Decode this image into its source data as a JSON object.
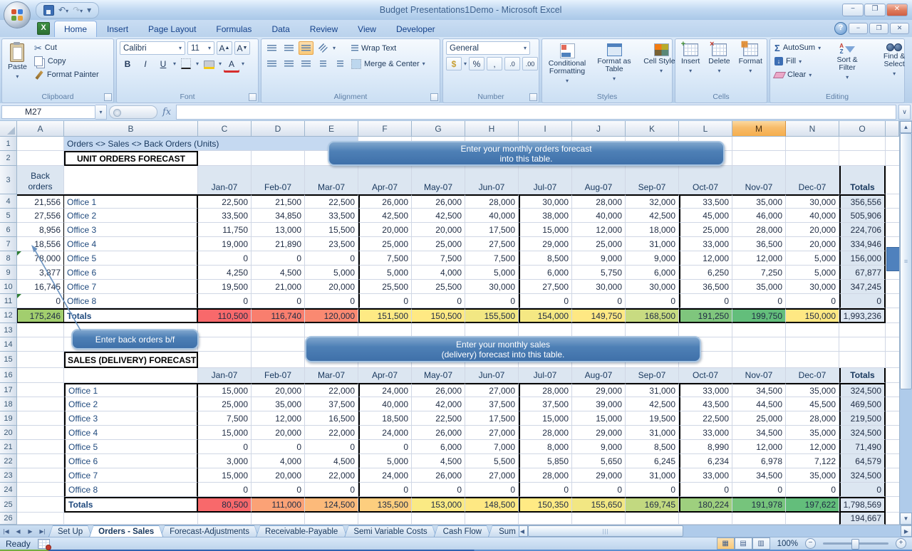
{
  "window": {
    "title": "Budget Presentations1Demo - Microsoft Excel"
  },
  "ribbon_tabs": [
    {
      "label": "Home",
      "active": true
    },
    {
      "label": "Insert"
    },
    {
      "label": "Page Layout"
    },
    {
      "label": "Formulas"
    },
    {
      "label": "Data"
    },
    {
      "label": "Review"
    },
    {
      "label": "View"
    },
    {
      "label": "Developer"
    }
  ],
  "ribbon": {
    "clipboard": {
      "label": "Clipboard",
      "paste": "Paste",
      "cut": "Cut",
      "copy": "Copy",
      "format_painter": "Format Painter"
    },
    "font": {
      "label": "Font",
      "family": "Calibri",
      "size": "11"
    },
    "alignment": {
      "label": "Alignment",
      "wrap": "Wrap Text",
      "merge": "Merge & Center"
    },
    "number": {
      "label": "Number",
      "format": "General"
    },
    "styles": {
      "label": "Styles",
      "conditional": "Conditional Formatting",
      "format_table": "Format as Table",
      "cell_styles": "Cell Styles"
    },
    "cells": {
      "label": "Cells",
      "insert": "Insert",
      "delete": "Delete",
      "format": "Format"
    },
    "editing": {
      "label": "Editing",
      "autosum": "AutoSum",
      "fill": "Fill",
      "clear": "Clear",
      "sort": "Sort & Filter",
      "find": "Find & Select"
    }
  },
  "formula_bar": {
    "name_box": "M27"
  },
  "sheet": {
    "columns": [
      "A",
      "B",
      "C",
      "D",
      "E",
      "F",
      "G",
      "H",
      "I",
      "J",
      "K",
      "L",
      "M",
      "N",
      "O"
    ],
    "selected_column": "M",
    "banner": "Orders <> Sales <> Back Orders (Units)",
    "months": [
      "Jan-07",
      "Feb-07",
      "Mar-07",
      "Apr-07",
      "May-07",
      "Jun-07",
      "Jul-07",
      "Aug-07",
      "Sep-07",
      "Oct-07",
      "Nov-07",
      "Dec-07"
    ],
    "totals_header": "Totals",
    "orders": {
      "title": "UNIT ORDERS FORECAST",
      "row_header": "Back\norders",
      "rows": [
        {
          "back": "21,556",
          "office": "Office 1",
          "values": [
            "22,500",
            "21,500",
            "22,500",
            "26,000",
            "26,000",
            "28,000",
            "30,000",
            "28,000",
            "32,000",
            "33,500",
            "35,000",
            "30,000"
          ],
          "total": "356,556"
        },
        {
          "back": "27,556",
          "office": "Office 2",
          "values": [
            "33,500",
            "34,850",
            "33,500",
            "42,500",
            "42,500",
            "40,000",
            "38,000",
            "40,000",
            "42,500",
            "45,000",
            "46,000",
            "40,000"
          ],
          "total": "505,906"
        },
        {
          "back": "8,956",
          "office": "Office 3",
          "values": [
            "11,750",
            "13,000",
            "15,500",
            "20,000",
            "20,000",
            "17,500",
            "15,000",
            "12,000",
            "18,000",
            "25,000",
            "28,000",
            "20,000"
          ],
          "total": "224,706"
        },
        {
          "back": "18,556",
          "office": "Office 4",
          "values": [
            "19,000",
            "21,890",
            "23,500",
            "25,000",
            "25,000",
            "27,500",
            "29,000",
            "25,000",
            "31,000",
            "33,000",
            "36,500",
            "20,000"
          ],
          "total": "334,946"
        },
        {
          "back": "78,000",
          "office": "Office 5",
          "values": [
            "0",
            "0",
            "0",
            "7,500",
            "7,500",
            "7,500",
            "8,500",
            "9,000",
            "9,000",
            "12,000",
            "12,000",
            "5,000"
          ],
          "total": "156,000"
        },
        {
          "back": "3,877",
          "office": "Office 6",
          "values": [
            "4,250",
            "4,500",
            "5,000",
            "5,000",
            "4,000",
            "5,000",
            "6,000",
            "5,750",
            "6,000",
            "6,250",
            "7,250",
            "5,000"
          ],
          "total": "67,877"
        },
        {
          "back": "16,745",
          "office": "Office 7",
          "values": [
            "19,500",
            "21,000",
            "20,000",
            "25,500",
            "25,500",
            "30,000",
            "27,500",
            "30,000",
            "30,000",
            "36,500",
            "35,000",
            "30,000"
          ],
          "total": "347,245"
        },
        {
          "back": "0",
          "office": "Office 8",
          "values": [
            "0",
            "0",
            "0",
            "0",
            "0",
            "0",
            "0",
            "0",
            "0",
            "0",
            "0",
            "0"
          ],
          "total": "0"
        }
      ],
      "totals_label": "Totals",
      "totals": {
        "back": "175,246",
        "back_color": "#A2CE6E",
        "values": [
          "110,500",
          "116,740",
          "120,000",
          "151,500",
          "150,500",
          "155,500",
          "154,000",
          "149,750",
          "168,500",
          "191,250",
          "199,750",
          "150,000"
        ],
        "colors": [
          "#F8696B",
          "#F97E6E",
          "#FA8971",
          "#FEEA84",
          "#FFE983",
          "#F2E783",
          "#F5E883",
          "#FEE883",
          "#C8DB81",
          "#7FC67D",
          "#63BE7B",
          "#FEE883"
        ],
        "grand": "1,993,236"
      }
    },
    "sales": {
      "title": "SALES (DELIVERY) FORECAST",
      "rows": [
        {
          "office": "Office 1",
          "values": [
            "15,000",
            "20,000",
            "22,000",
            "24,000",
            "26,000",
            "27,000",
            "28,000",
            "29,000",
            "31,000",
            "33,000",
            "34,500",
            "35,000"
          ],
          "total": "324,500"
        },
        {
          "office": "Office 2",
          "values": [
            "25,000",
            "35,000",
            "37,500",
            "40,000",
            "42,000",
            "37,500",
            "37,500",
            "39,000",
            "42,500",
            "43,500",
            "44,500",
            "45,500"
          ],
          "total": "469,500"
        },
        {
          "office": "Office 3",
          "values": [
            "7,500",
            "12,000",
            "16,500",
            "18,500",
            "22,500",
            "17,500",
            "15,000",
            "15,000",
            "19,500",
            "22,500",
            "25,000",
            "28,000"
          ],
          "total": "219,500"
        },
        {
          "office": "Office 4",
          "values": [
            "15,000",
            "20,000",
            "22,000",
            "24,000",
            "26,000",
            "27,000",
            "28,000",
            "29,000",
            "31,000",
            "33,000",
            "34,500",
            "35,000"
          ],
          "total": "324,500"
        },
        {
          "office": "Office 5",
          "values": [
            "0",
            "0",
            "0",
            "0",
            "6,000",
            "7,000",
            "8,000",
            "9,000",
            "8,500",
            "8,990",
            "12,000",
            "12,000"
          ],
          "total": "71,490"
        },
        {
          "office": "Office 6",
          "values": [
            "3,000",
            "4,000",
            "4,500",
            "5,000",
            "4,500",
            "5,500",
            "5,850",
            "5,650",
            "6,245",
            "6,234",
            "6,978",
            "7,122"
          ],
          "total": "64,579"
        },
        {
          "office": "Office 7",
          "values": [
            "15,000",
            "20,000",
            "22,000",
            "24,000",
            "26,000",
            "27,000",
            "28,000",
            "29,000",
            "31,000",
            "33,000",
            "34,500",
            "35,000"
          ],
          "total": "324,500"
        },
        {
          "office": "Office 8",
          "values": [
            "0",
            "0",
            "0",
            "0",
            "0",
            "0",
            "0",
            "0",
            "0",
            "0",
            "0",
            "0"
          ],
          "total": "0"
        }
      ],
      "totals_label": "Totals",
      "totals": {
        "values": [
          "80,500",
          "111,000",
          "124,500",
          "135,500",
          "153,000",
          "148,500",
          "150,350",
          "155,650",
          "169,745",
          "180,224",
          "191,978",
          "197,622"
        ],
        "colors": [
          "#F8696B",
          "#FBA276",
          "#FCBA7A",
          "#FDCE7E",
          "#FAEA84",
          "#FEE883",
          "#FFEA84",
          "#F2E783",
          "#C2D980",
          "#9ECF7E",
          "#76C47C",
          "#63BE7B"
        ],
        "grand": "1,798,569"
      }
    },
    "below_value": "194,667",
    "callouts": {
      "orders_line1": "Enter your monthly  orders forecast",
      "orders_line2": "into this table.",
      "back": "Enter back orders b/f",
      "sales_line1": "Enter your monthly sales",
      "sales_line2": "(delivery) forecast into this table."
    }
  },
  "sheet_tabs": {
    "tabs": [
      "Set Up",
      "Orders - Sales",
      "Forecast-Adjustments",
      "Receivable-Payable",
      "Semi Variable Costs",
      "Cash Flow",
      "Sum"
    ],
    "active": "Orders - Sales"
  },
  "status_bar": {
    "mode": "Ready",
    "zoom": "100%"
  }
}
